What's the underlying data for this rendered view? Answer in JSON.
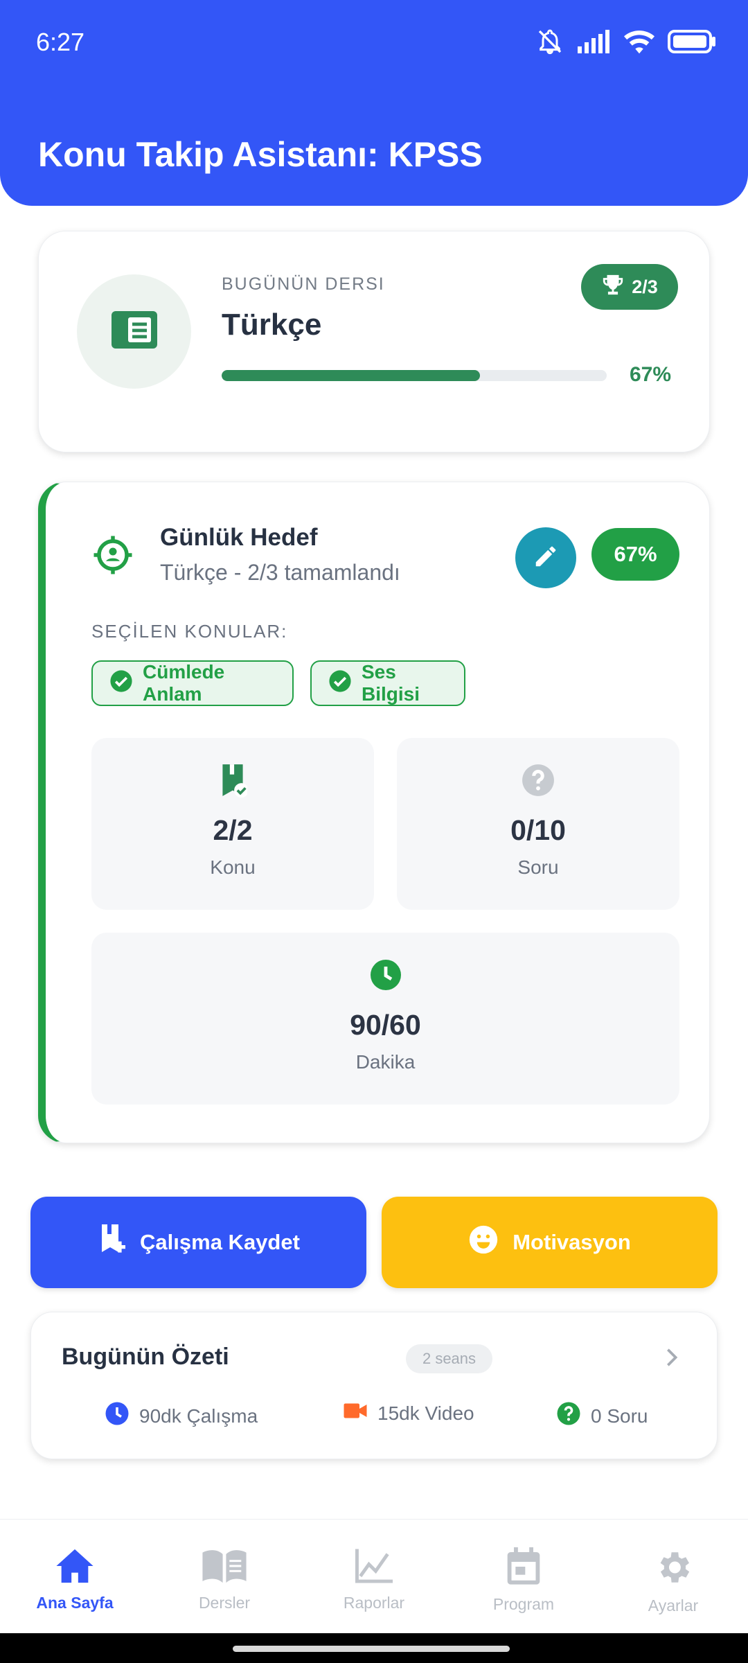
{
  "status_bar": {
    "time": "6:27"
  },
  "header": {
    "title": "Konu Takip Asistanı: KPSS"
  },
  "lesson_card": {
    "label": "BUGÜNÜN DERSI",
    "name": "Türkçe",
    "badge": "2/3",
    "progress_text": "67%",
    "progress_fraction": 0.67,
    "accent_color": "#2e8b58"
  },
  "goal_card": {
    "title": "Günlük Hedef",
    "subtitle": "Türkçe - 2/3 tamamlandı",
    "percent": "67%",
    "topics_label": "SEÇİLEN KONULAR:",
    "topics": [
      "Cümlede Anlam",
      "Ses Bilgisi"
    ],
    "stats": {
      "konu": {
        "value": "2/2",
        "label": "Konu"
      },
      "soru": {
        "value": "0/10",
        "label": "Soru"
      },
      "dakika": {
        "value": "90/60",
        "label": "Dakika"
      }
    },
    "accent_color": "#22a046"
  },
  "actions": {
    "save_label": "Çalışma Kaydet",
    "motivation_label": "Motivasyon"
  },
  "summary": {
    "title": "Bugünün Özeti",
    "sessions": "2 seans",
    "items": [
      "90dk Çalışma",
      "15dk Video",
      "0 Soru"
    ]
  },
  "bottom_nav": {
    "items": [
      "Ana Sayfa",
      "Dersler",
      "Raporlar",
      "Program",
      "Ayarlar"
    ],
    "active": "Ana Sayfa"
  },
  "colors": {
    "primary": "#3356f7",
    "yellow": "#fdc010",
    "teal": "#1c9ab4"
  }
}
